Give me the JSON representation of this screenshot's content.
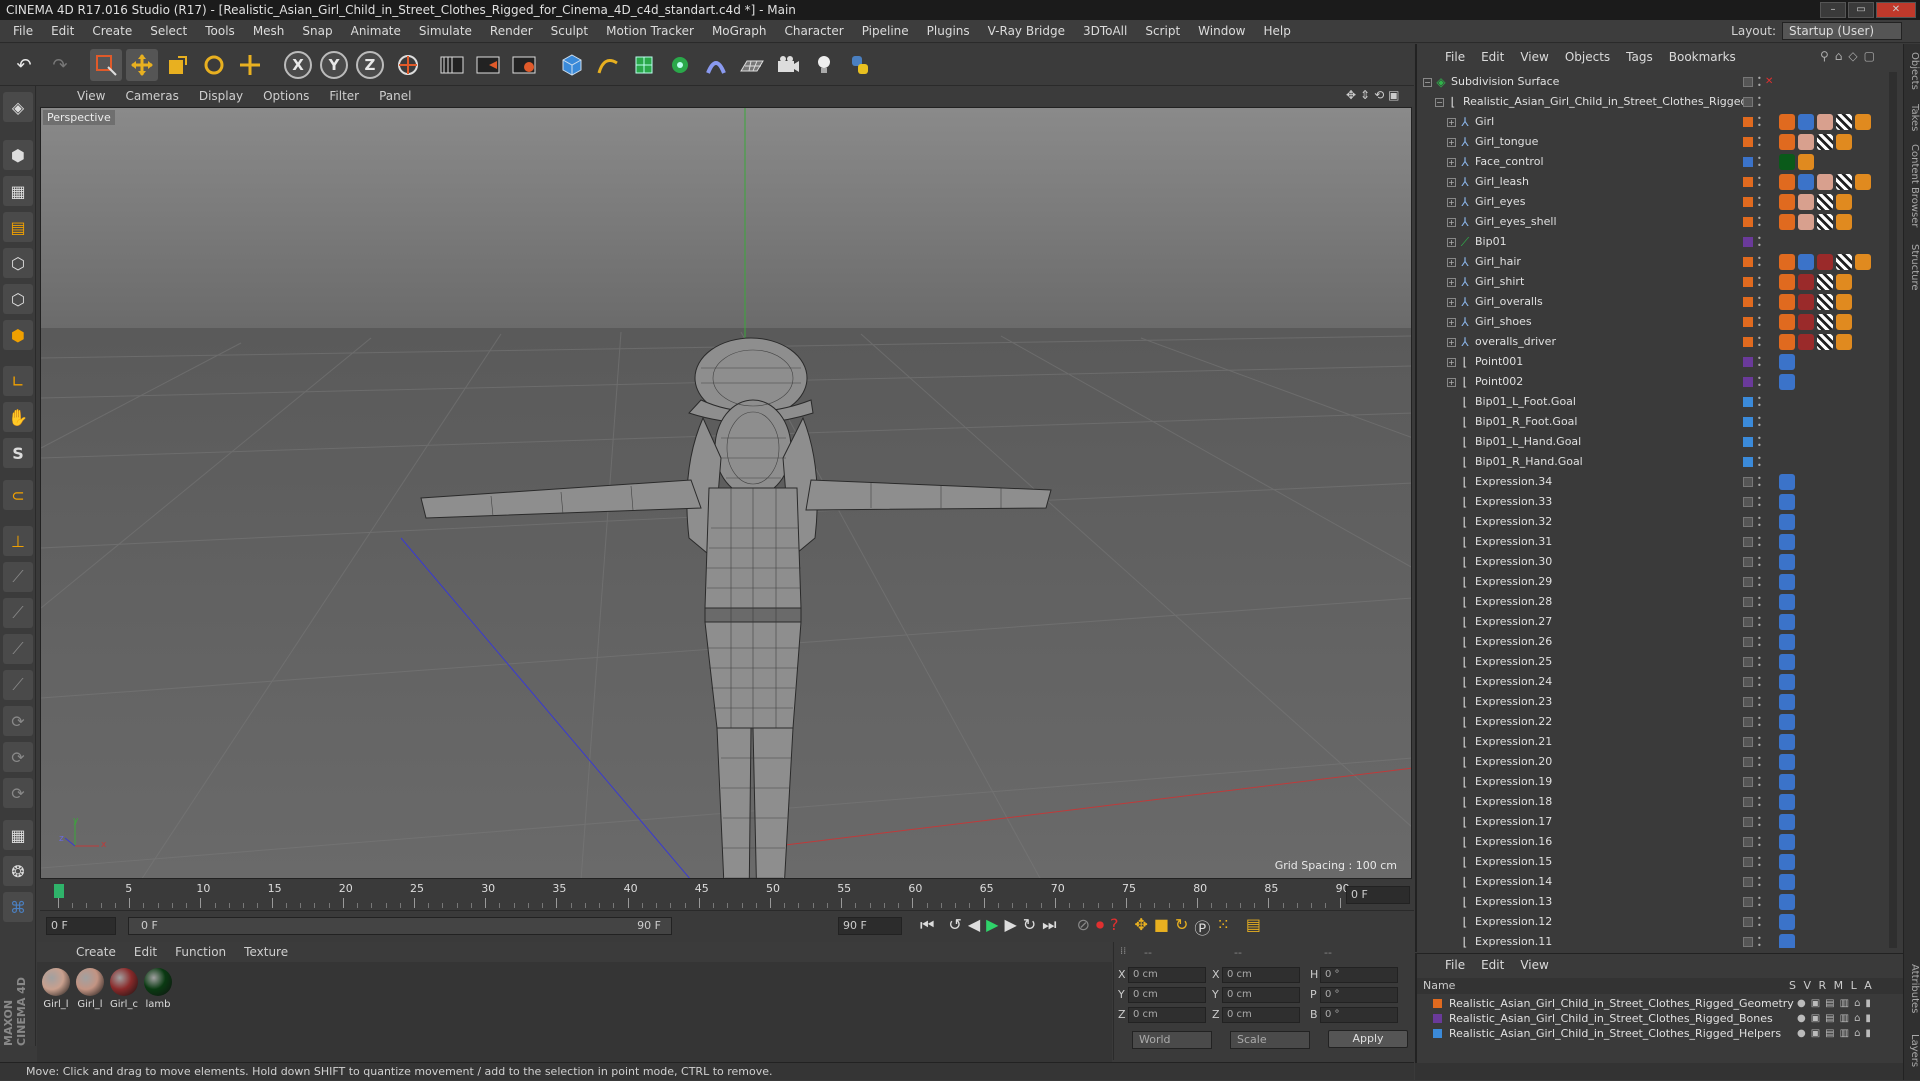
{
  "window": {
    "title": "CINEMA 4D R17.016 Studio (R17) - [Realistic_Asian_Girl_Child_in_Street_Clothes_Rigged_for_Cinema_4D_c4d_standart.c4d *] - Main",
    "buttons": [
      "–",
      "▭",
      "✕"
    ]
  },
  "menubar": [
    "File",
    "Edit",
    "Create",
    "Select",
    "Tools",
    "Mesh",
    "Snap",
    "Animate",
    "Simulate",
    "Render",
    "Sculpt",
    "Motion Tracker",
    "MoGraph",
    "Character",
    "Pipeline",
    "Plugins",
    "V-Ray Bridge",
    "3DToAll",
    "Script",
    "Window",
    "Help"
  ],
  "layout": {
    "label": "Layout:",
    "value": "Startup (User)"
  },
  "toolbar": {
    "axis": [
      "X",
      "Y",
      "Z"
    ],
    "icons": [
      "undo-icon",
      "redo-icon",
      "live-selection-icon",
      "move-icon",
      "scale-icon",
      "rotate-icon",
      "transform-icon",
      "world-coordinate-icon",
      "render-view-icon",
      "render-picture-viewer-icon",
      "edit-render-settings-icon",
      "cube-icon",
      "spline-pen-icon",
      "subdivision-icon",
      "array-icon",
      "deformer-icon",
      "floor-icon",
      "camera-icon",
      "light-icon",
      "python-icon"
    ]
  },
  "viewport": {
    "menu": [
      "View",
      "Cameras",
      "Display",
      "Options",
      "Filter",
      "Panel"
    ],
    "label": "Perspective",
    "grid_spacing": "Grid Spacing : 100 cm",
    "axes": {
      "x": "x",
      "y": "y",
      "z": "z"
    }
  },
  "timeline": {
    "ticks": [
      "0",
      "5",
      "10",
      "15",
      "20",
      "25",
      "30",
      "35",
      "40",
      "45",
      "50",
      "55",
      "60",
      "65",
      "70",
      "75",
      "80",
      "85",
      "90"
    ],
    "current_frame_right": "0 F",
    "start_field": "0 F",
    "range_start": "0 F",
    "range_end": "90 F",
    "end_field": "90 F"
  },
  "materials": {
    "menu": [
      "Create",
      "Edit",
      "Function",
      "Texture"
    ],
    "items": [
      {
        "name": "Girl_l",
        "color": "#c9a08e"
      },
      {
        "name": "Girl_l",
        "color": "#c39483"
      },
      {
        "name": "Girl_c",
        "color": "#8a2a2a"
      },
      {
        "name": "lamb",
        "color": "#0a3a12"
      }
    ]
  },
  "coords": {
    "header": [
      "--",
      "--",
      "--"
    ],
    "rows": [
      {
        "a": "X",
        "av": "0 cm",
        "b": "X",
        "bv": "0 cm",
        "c": "H",
        "cv": "0 °"
      },
      {
        "a": "Y",
        "av": "0 cm",
        "b": "Y",
        "bv": "0 cm",
        "c": "P",
        "cv": "0 °"
      },
      {
        "a": "Z",
        "av": "0 cm",
        "b": "Z",
        "bv": "0 cm",
        "c": "B",
        "cv": "0 °"
      }
    ],
    "mode": "World",
    "scale": "Scale",
    "apply": "Apply"
  },
  "status": "Move: Click and drag to move elements. Hold down SHIFT to quantize movement / add to the selection in point mode, CTRL to remove.",
  "brand": "MAXON CINEMA 4D",
  "objects": {
    "menu": [
      "File",
      "Edit",
      "View",
      "Objects",
      "Tags",
      "Bookmarks"
    ],
    "rows": [
      {
        "name": "Subdivision Surface",
        "indent": 0,
        "type": "subdiv",
        "layer": "",
        "tags": []
      },
      {
        "name": "Realistic_Asian_Girl_Child_in_Street_Clothes_Rigged",
        "indent": 1,
        "type": "null",
        "layer": "",
        "tags": []
      },
      {
        "name": "Girl",
        "indent": 2,
        "type": "mesh",
        "layer": "#e06a1f",
        "tags": [
          "#e06a1f",
          "#3b73c9",
          "#d8a08e",
          "#ffffff",
          "#e08a1f"
        ]
      },
      {
        "name": "Girl_tongue",
        "indent": 2,
        "type": "mesh",
        "layer": "#e06a1f",
        "tags": [
          "#e06a1f",
          "#d8a08e",
          "#ffffff",
          "#e08a1f"
        ]
      },
      {
        "name": "Face_control",
        "indent": 2,
        "type": "mesh",
        "layer": "#3b73c9",
        "tags": [
          "#0a5a1a",
          "#e08a1f"
        ]
      },
      {
        "name": "Girl_leash",
        "indent": 2,
        "type": "mesh",
        "layer": "#e06a1f",
        "tags": [
          "#e06a1f",
          "#3b73c9",
          "#d8a08e",
          "#ffffff",
          "#e08a1f"
        ]
      },
      {
        "name": "Girl_eyes",
        "indent": 2,
        "type": "mesh",
        "layer": "#e06a1f",
        "tags": [
          "#e06a1f",
          "#d8a08e",
          "#ffffff",
          "#e08a1f"
        ]
      },
      {
        "name": "Girl_eyes_shell",
        "indent": 2,
        "type": "mesh",
        "layer": "#e06a1f",
        "tags": [
          "#e06a1f",
          "#d8a08e",
          "#ffffff",
          "#e08a1f"
        ]
      },
      {
        "name": "Bip01",
        "indent": 2,
        "type": "bone",
        "layer": "#6a3a9a",
        "tags": []
      },
      {
        "name": "Girl_hair",
        "indent": 2,
        "type": "mesh",
        "layer": "#e06a1f",
        "tags": [
          "#e06a1f",
          "#3b73c9",
          "#9a2a2a",
          "#ffffff",
          "#e08a1f"
        ]
      },
      {
        "name": "Girl_shirt",
        "indent": 2,
        "type": "mesh",
        "layer": "#e06a1f",
        "tags": [
          "#e06a1f",
          "#9a2a2a",
          "#ffffff",
          "#e08a1f"
        ]
      },
      {
        "name": "Girl_overalls",
        "indent": 2,
        "type": "mesh",
        "layer": "#e06a1f",
        "tags": [
          "#e06a1f",
          "#9a2a2a",
          "#ffffff",
          "#e08a1f"
        ]
      },
      {
        "name": "Girl_shoes",
        "indent": 2,
        "type": "mesh",
        "layer": "#e06a1f",
        "tags": [
          "#e06a1f",
          "#9a2a2a",
          "#ffffff",
          "#e08a1f"
        ]
      },
      {
        "name": "overalls_driver",
        "indent": 2,
        "type": "mesh",
        "layer": "#e06a1f",
        "tags": [
          "#e06a1f",
          "#9a2a2a",
          "#ffffff",
          "#e08a1f"
        ]
      },
      {
        "name": "Point001",
        "indent": 2,
        "type": "null",
        "layer": "#6a3a9a",
        "tags": [
          "#3b73c9"
        ]
      },
      {
        "name": "Point002",
        "indent": 2,
        "type": "null",
        "layer": "#6a3a9a",
        "tags": [
          "#3b73c9"
        ]
      },
      {
        "name": "Bip01_L_Foot.Goal",
        "indent": 2,
        "type": "null",
        "layer": "#3b8ad9",
        "tags": []
      },
      {
        "name": "Bip01_R_Foot.Goal",
        "indent": 2,
        "type": "null",
        "layer": "#3b8ad9",
        "tags": []
      },
      {
        "name": "Bip01_L_Hand.Goal",
        "indent": 2,
        "type": "null",
        "layer": "#3b8ad9",
        "tags": []
      },
      {
        "name": "Bip01_R_Hand.Goal",
        "indent": 2,
        "type": "null",
        "layer": "#3b8ad9",
        "tags": []
      },
      {
        "name": "Expression.34",
        "indent": 2,
        "type": "null",
        "layer": "",
        "tags": [
          "#3b73c9"
        ]
      },
      {
        "name": "Expression.33",
        "indent": 2,
        "type": "null",
        "layer": "",
        "tags": [
          "#3b73c9"
        ]
      },
      {
        "name": "Expression.32",
        "indent": 2,
        "type": "null",
        "layer": "",
        "tags": [
          "#3b73c9"
        ]
      },
      {
        "name": "Expression.31",
        "indent": 2,
        "type": "null",
        "layer": "",
        "tags": [
          "#3b73c9"
        ]
      },
      {
        "name": "Expression.30",
        "indent": 2,
        "type": "null",
        "layer": "",
        "tags": [
          "#3b73c9"
        ]
      },
      {
        "name": "Expression.29",
        "indent": 2,
        "type": "null",
        "layer": "",
        "tags": [
          "#3b73c9"
        ]
      },
      {
        "name": "Expression.28",
        "indent": 2,
        "type": "null",
        "layer": "",
        "tags": [
          "#3b73c9"
        ]
      },
      {
        "name": "Expression.27",
        "indent": 2,
        "type": "null",
        "layer": "",
        "tags": [
          "#3b73c9"
        ]
      },
      {
        "name": "Expression.26",
        "indent": 2,
        "type": "null",
        "layer": "",
        "tags": [
          "#3b73c9"
        ]
      },
      {
        "name": "Expression.25",
        "indent": 2,
        "type": "null",
        "layer": "",
        "tags": [
          "#3b73c9"
        ]
      },
      {
        "name": "Expression.24",
        "indent": 2,
        "type": "null",
        "layer": "",
        "tags": [
          "#3b73c9"
        ]
      },
      {
        "name": "Expression.23",
        "indent": 2,
        "type": "null",
        "layer": "",
        "tags": [
          "#3b73c9"
        ]
      },
      {
        "name": "Expression.22",
        "indent": 2,
        "type": "null",
        "layer": "",
        "tags": [
          "#3b73c9"
        ]
      },
      {
        "name": "Expression.21",
        "indent": 2,
        "type": "null",
        "layer": "",
        "tags": [
          "#3b73c9"
        ]
      },
      {
        "name": "Expression.20",
        "indent": 2,
        "type": "null",
        "layer": "",
        "tags": [
          "#3b73c9"
        ]
      },
      {
        "name": "Expression.19",
        "indent": 2,
        "type": "null",
        "layer": "",
        "tags": [
          "#3b73c9"
        ]
      },
      {
        "name": "Expression.18",
        "indent": 2,
        "type": "null",
        "layer": "",
        "tags": [
          "#3b73c9"
        ]
      },
      {
        "name": "Expression.17",
        "indent": 2,
        "type": "null",
        "layer": "",
        "tags": [
          "#3b73c9"
        ]
      },
      {
        "name": "Expression.16",
        "indent": 2,
        "type": "null",
        "layer": "",
        "tags": [
          "#3b73c9"
        ]
      },
      {
        "name": "Expression.15",
        "indent": 2,
        "type": "null",
        "layer": "",
        "tags": [
          "#3b73c9"
        ]
      },
      {
        "name": "Expression.14",
        "indent": 2,
        "type": "null",
        "layer": "",
        "tags": [
          "#3b73c9"
        ]
      },
      {
        "name": "Expression.13",
        "indent": 2,
        "type": "null",
        "layer": "",
        "tags": [
          "#3b73c9"
        ]
      },
      {
        "name": "Expression.12",
        "indent": 2,
        "type": "null",
        "layer": "",
        "tags": [
          "#3b73c9"
        ]
      },
      {
        "name": "Expression.11",
        "indent": 2,
        "type": "null",
        "layer": "",
        "tags": [
          "#3b73c9"
        ]
      }
    ]
  },
  "layers": {
    "menu": [
      "File",
      "Edit",
      "View"
    ],
    "header_name": "Name",
    "header_cols": "S V R M L A",
    "rows": [
      {
        "name": "Realistic_Asian_Girl_Child_in_Street_Clothes_Rigged_Geometry",
        "color": "#e06a1f"
      },
      {
        "name": "Realistic_Asian_Girl_Child_in_Street_Clothes_Rigged_Bones",
        "color": "#6a3a9a"
      },
      {
        "name": "Realistic_Asian_Girl_Child_in_Street_Clothes_Rigged_Helpers",
        "color": "#3b8ad9"
      }
    ]
  },
  "sidetabs": [
    "Objects",
    "Takes",
    "Content Browser",
    "Structure",
    "Attributes",
    "Layers"
  ]
}
